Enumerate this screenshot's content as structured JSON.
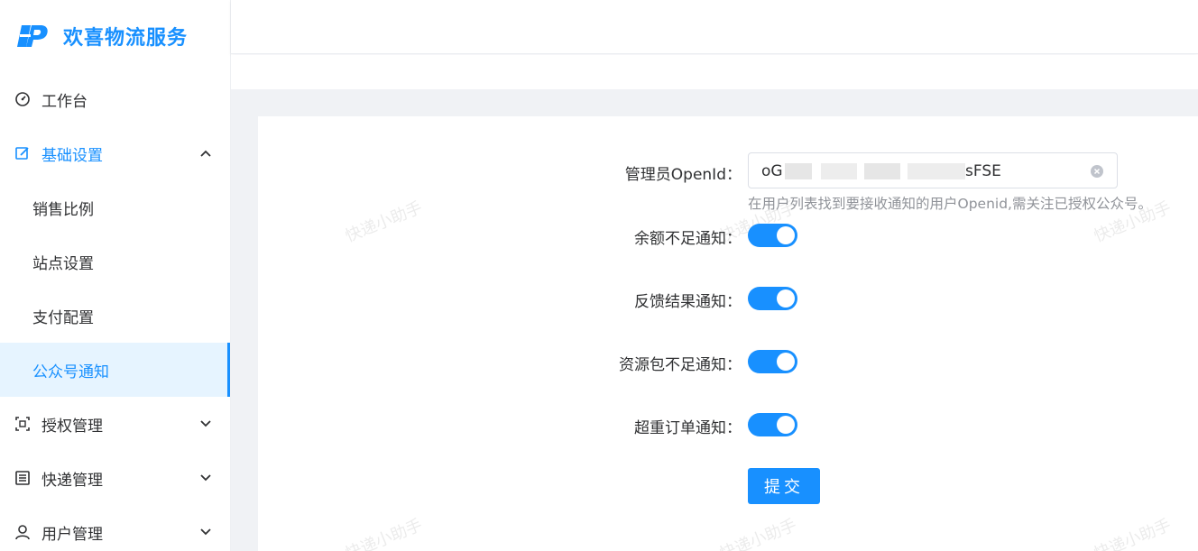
{
  "brand": {
    "title": "欢喜物流服务",
    "logo_icon": "logo-p-icon",
    "color": "#1890ff"
  },
  "sidebar": {
    "items": [
      {
        "label": "工作台",
        "icon": "dashboard-icon"
      },
      {
        "label": "基础设置",
        "icon": "edit-icon",
        "expanded": true,
        "children": [
          "销售比例",
          "站点设置",
          "支付配置",
          "公众号通知"
        ],
        "active_child": "公众号通知"
      },
      {
        "label": "授权管理",
        "icon": "scan-icon",
        "expanded": false
      },
      {
        "label": "快递管理",
        "icon": "list-icon",
        "expanded": false
      },
      {
        "label": "用户管理",
        "icon": "user-icon",
        "expanded": false
      }
    ]
  },
  "form": {
    "openid": {
      "label": "管理员OpenId：",
      "value_prefix": "oG",
      "value_suffix": "sFSE",
      "hint": "在用户列表找到要接收通知的用户Openid,需关注已授权公众号。"
    },
    "switches": [
      {
        "label": "余额不足通知：",
        "on": true
      },
      {
        "label": "反馈结果通知：",
        "on": true
      },
      {
        "label": "资源包不足通知：",
        "on": true
      },
      {
        "label": "超重订单通知：",
        "on": true
      }
    ],
    "submit_label": "提交"
  },
  "watermark_text": "快递小助手",
  "colors": {
    "accent": "#1890ff",
    "active_bg": "#e6f4ff",
    "content_bg": "#f0f2f5"
  }
}
